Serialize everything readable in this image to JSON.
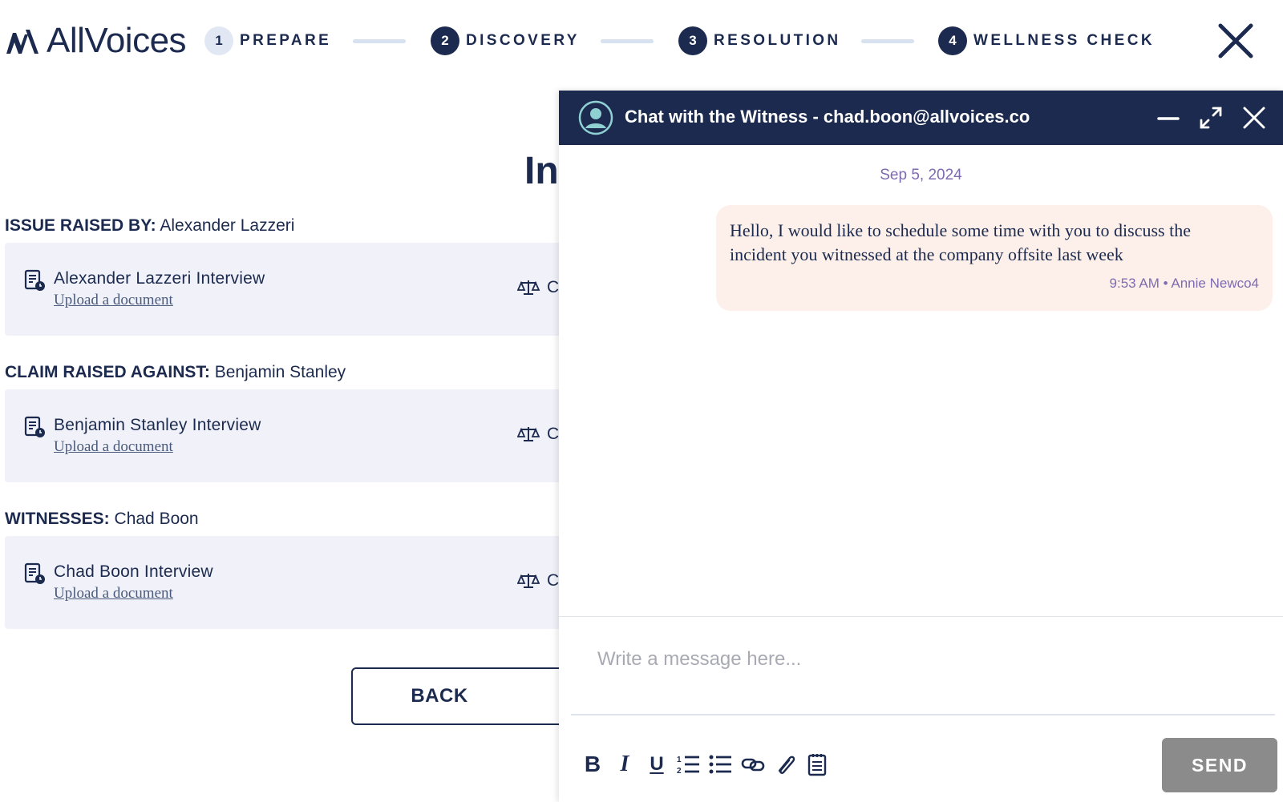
{
  "brand": {
    "logo_text": "AllVoices"
  },
  "stepper": {
    "steps": [
      {
        "num": "1",
        "label": "PREPARE",
        "state": "inactive"
      },
      {
        "num": "2",
        "label": "DISCOVERY",
        "state": "active"
      },
      {
        "num": "3",
        "label": "RESOLUTION",
        "state": "active"
      },
      {
        "num": "4",
        "label": "WELLNESS CHECK",
        "state": "active"
      }
    ]
  },
  "main": {
    "title_partial": "In",
    "sections": [
      {
        "heading_label": "ISSUE RAISED BY:",
        "heading_value": "Alexander Lazzeri",
        "card_title": "Alexander Lazzeri Interview",
        "card_link": "Upload a document",
        "card_cut_text": "C"
      },
      {
        "heading_label": "CLAIM RAISED AGAINST:",
        "heading_value": "Benjamin Stanley",
        "card_title": "Benjamin Stanley Interview",
        "card_link": "Upload a document",
        "card_cut_text": "C"
      },
      {
        "heading_label": "WITNESSES:",
        "heading_value": "Chad Boon",
        "card_title": "Chad Boon Interview",
        "card_link": "Upload a document",
        "card_cut_text": "C"
      }
    ],
    "back_label": "BACK"
  },
  "chat": {
    "title": "Chat with the Witness - chad.boon@allvoices.co",
    "date": "Sep 5, 2024",
    "messages": [
      {
        "text": "Hello, I would like to schedule some time with you to discuss the incident you witnessed at the company offsite last week",
        "meta": "9:53 AM • Annie Newco4"
      }
    ],
    "input_placeholder": "Write a message here...",
    "send_label": "SEND",
    "toolbar": [
      "bold-icon",
      "italic-icon",
      "underline-icon",
      "ordered-list-icon",
      "bullet-list-icon",
      "link-icon",
      "attachment-icon",
      "clipboard-icon"
    ]
  },
  "colors": {
    "navy": "#1b2a4e",
    "card_bg": "#f1f2f9",
    "bubble_bg": "#fdf0ea",
    "muted_purple": "#7e6bb0",
    "send_disabled": "#8b8b8b"
  }
}
